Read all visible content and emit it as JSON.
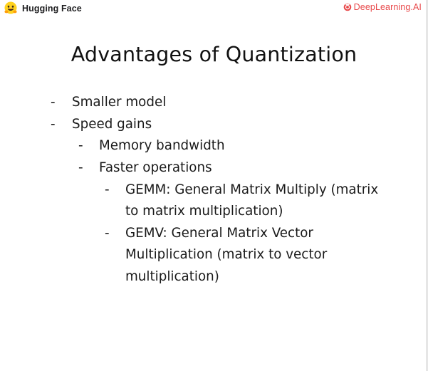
{
  "header": {
    "left_logo_text": "Hugging Face",
    "left_logo_icon": "hugging-face-emoji-icon",
    "right_logo_text": "DeepLearning.AI",
    "right_logo_icon": "deeplearning-ai-icon",
    "accent_color": "#e8484a"
  },
  "slide": {
    "title": "Advantages of Quantization",
    "bullets": [
      {
        "level": 1,
        "lines": [
          "Smaller model"
        ]
      },
      {
        "level": 1,
        "lines": [
          "Speed gains"
        ]
      },
      {
        "level": 2,
        "lines": [
          "Memory bandwidth"
        ]
      },
      {
        "level": 2,
        "lines": [
          "Faster operations"
        ]
      },
      {
        "level": 3,
        "lines": [
          "GEMM: General Matrix Multiply (matrix",
          "to matrix multiplication)"
        ]
      },
      {
        "level": 3,
        "lines": [
          "GEMV: General Matrix Vector",
          "Multiplication (matrix to vector",
          "multiplication)"
        ]
      }
    ],
    "dash": "-"
  }
}
